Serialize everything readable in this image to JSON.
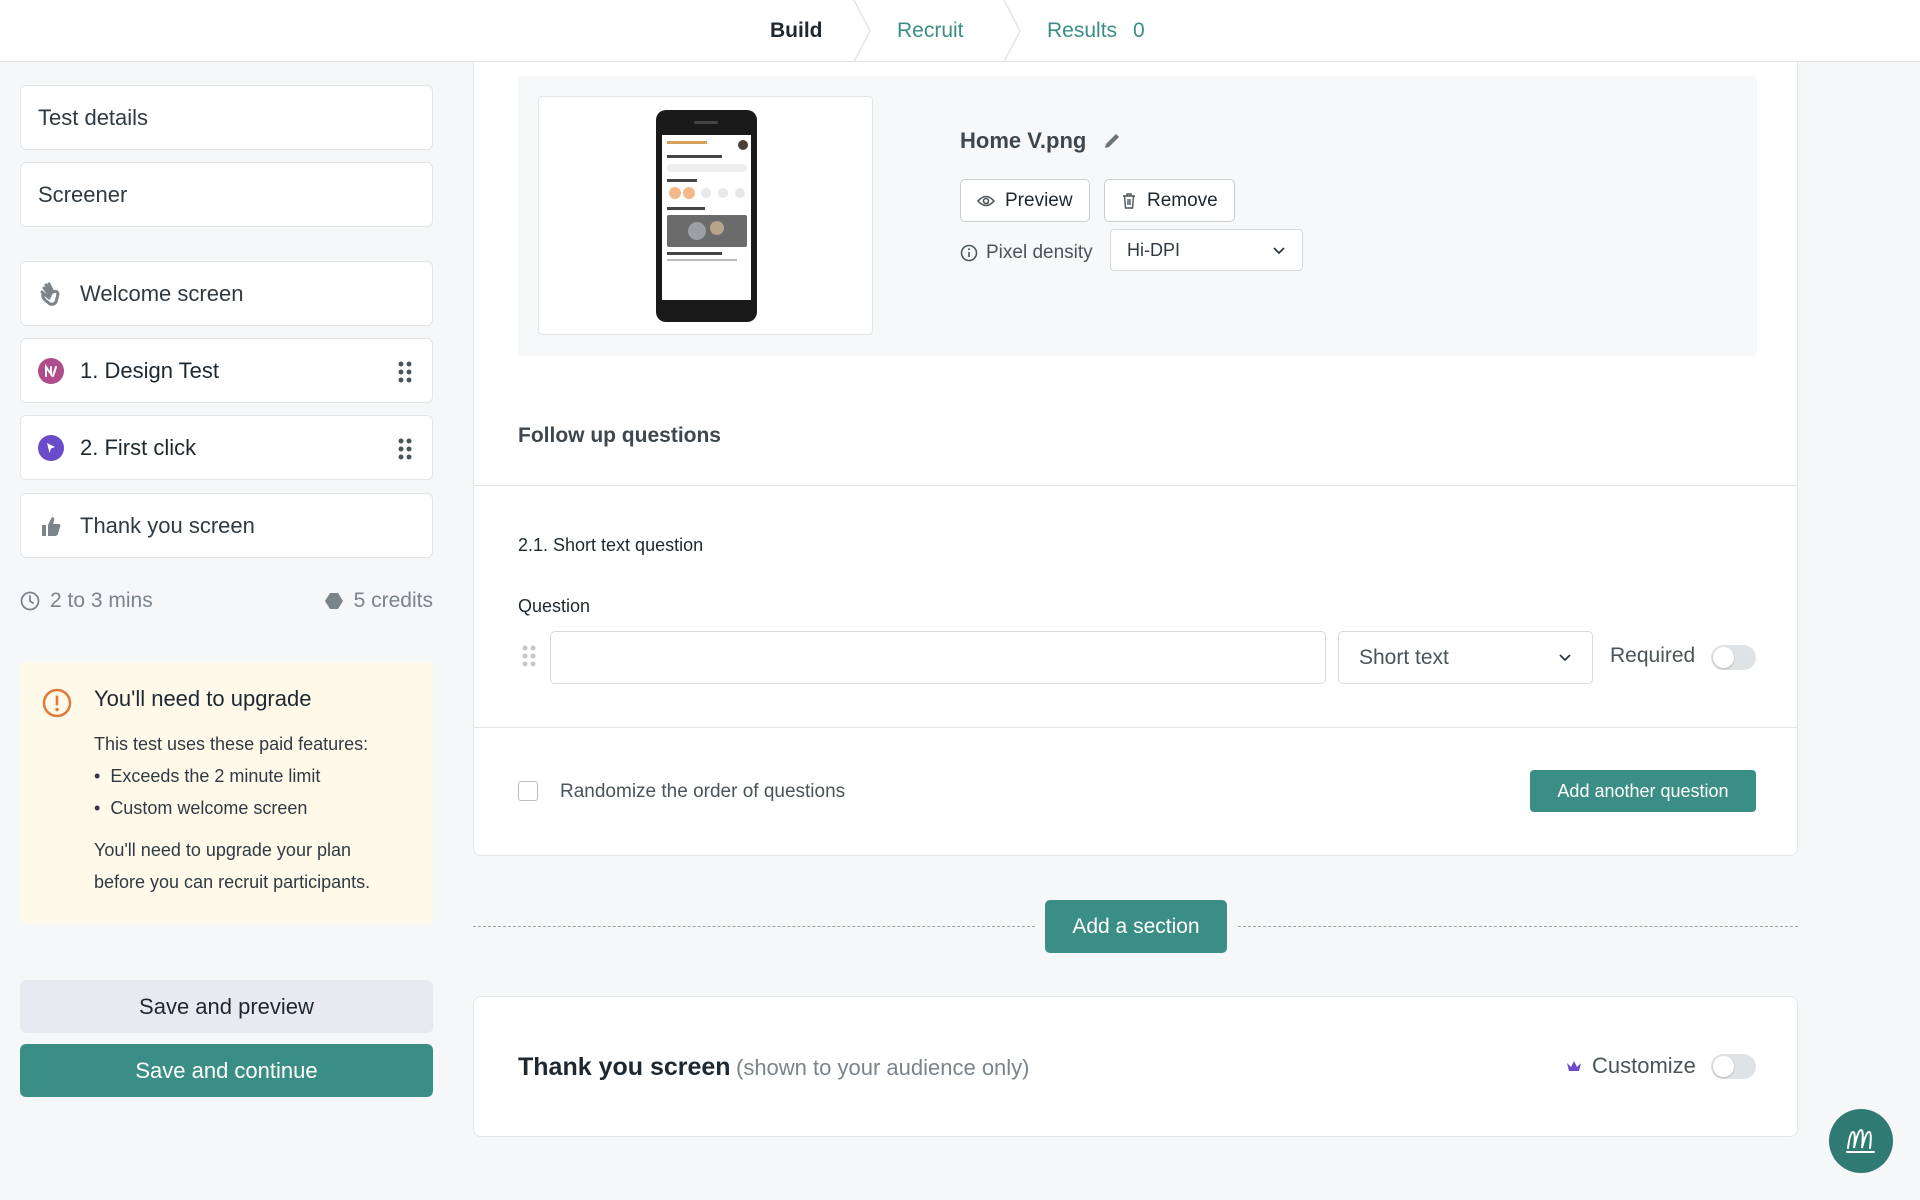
{
  "nav": {
    "build": "Build",
    "recruit": "Recruit",
    "results": "Results",
    "results_count": "0"
  },
  "sidebar": {
    "test_details": "Test details",
    "screener": "Screener",
    "welcome": "Welcome screen",
    "design_test": "1. Design Test",
    "first_click": "2. First click",
    "thank_you": "Thank you screen",
    "duration": "2 to 3 mins",
    "credits": "5 credits"
  },
  "upgrade": {
    "title": "You'll need to upgrade",
    "intro": "This test uses these paid features:",
    "features": [
      "Exceeds the 2 minute limit",
      "Custom welcome screen"
    ],
    "footer_line1": "You'll need to upgrade your plan",
    "footer_line2": "before you can recruit participants."
  },
  "actions": {
    "save_preview": "Save and preview",
    "save_continue": "Save and continue"
  },
  "image": {
    "file_name": "Home V.png",
    "preview": "Preview",
    "remove": "Remove",
    "pixel_density_label": "Pixel density",
    "pixel_density_value": "Hi-DPI"
  },
  "follow_up": {
    "heading": "Follow up questions",
    "question_title": "2.1. Short text question",
    "question_label": "Question",
    "question_value": "",
    "type": "Short text",
    "required_label": "Required",
    "randomize_label": "Randomize the order of questions",
    "add_question": "Add another question"
  },
  "add_section": "Add a section",
  "thank_you_card": {
    "title": "Thank you screen",
    "subtitle": "(shown to your audience only)",
    "customize": "Customize"
  },
  "colors": {
    "primary": "#3b8e86",
    "upgrade_bg": "#fff9ea",
    "warning": "#e07a3a"
  }
}
